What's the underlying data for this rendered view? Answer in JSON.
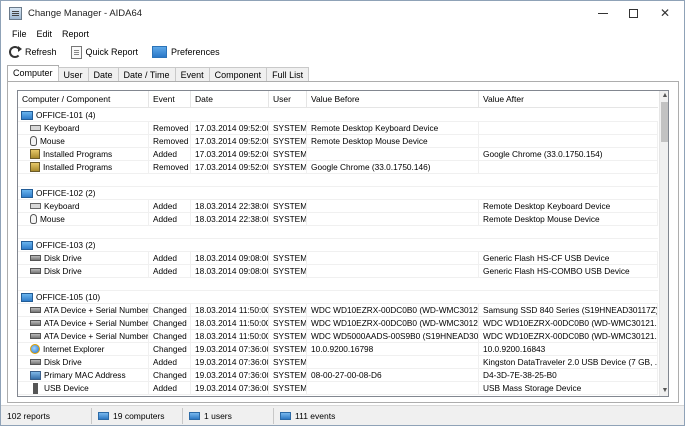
{
  "window": {
    "title": "Change Manager - AIDA64"
  },
  "menu": [
    "File",
    "Edit",
    "Report"
  ],
  "toolbar": {
    "refresh": "Refresh",
    "quick_report": "Quick Report",
    "preferences": "Preferences"
  },
  "tabs": [
    "Computer",
    "User",
    "Date",
    "Date / Time",
    "Event",
    "Component",
    "Full List"
  ],
  "columns": [
    "Computer / Component",
    "Event",
    "Date",
    "User",
    "Value Before",
    "Value After"
  ],
  "groups": [
    {
      "name": "OFFICE-101 (4)",
      "rows": [
        {
          "icon": "keyboard-icon",
          "component": "Keyboard",
          "event": "Removed",
          "date": "17.03.2014 09:52:00",
          "user": "SYSTEM",
          "before": "Remote Desktop Keyboard Device",
          "after": ""
        },
        {
          "icon": "mouse-icon",
          "component": "Mouse",
          "event": "Removed",
          "date": "17.03.2014 09:52:00",
          "user": "SYSTEM",
          "before": "Remote Desktop Mouse Device",
          "after": ""
        },
        {
          "icon": "installed-programs-icon",
          "component": "Installed Programs",
          "event": "Added",
          "date": "17.03.2014 09:52:00",
          "user": "SYSTEM",
          "before": "",
          "after": "Google Chrome (33.0.1750.154)"
        },
        {
          "icon": "installed-programs-icon",
          "component": "Installed Programs",
          "event": "Removed",
          "date": "17.03.2014 09:52:00",
          "user": "SYSTEM",
          "before": "Google Chrome (33.0.1750.146)",
          "after": ""
        }
      ]
    },
    {
      "name": "OFFICE-102 (2)",
      "rows": [
        {
          "icon": "keyboard-icon",
          "component": "Keyboard",
          "event": "Added",
          "date": "18.03.2014 22:38:00",
          "user": "SYSTEM",
          "before": "",
          "after": "Remote Desktop Keyboard Device"
        },
        {
          "icon": "mouse-icon",
          "component": "Mouse",
          "event": "Added",
          "date": "18.03.2014 22:38:00",
          "user": "SYSTEM",
          "before": "",
          "after": "Remote Desktop Mouse Device"
        }
      ]
    },
    {
      "name": "OFFICE-103 (2)",
      "rows": [
        {
          "icon": "disk-drive-icon",
          "component": "Disk Drive",
          "event": "Added",
          "date": "18.03.2014 09:08:00",
          "user": "SYSTEM",
          "before": "",
          "after": "Generic Flash HS-CF USB Device"
        },
        {
          "icon": "disk-drive-icon",
          "component": "Disk Drive",
          "event": "Added",
          "date": "18.03.2014 09:08:00",
          "user": "SYSTEM",
          "before": "",
          "after": "Generic Flash HS-COMBO USB Device"
        }
      ]
    },
    {
      "name": "OFFICE-105 (10)",
      "rows": [
        {
          "icon": "disk-drive-icon",
          "component": "ATA Device + Serial Number",
          "event": "Changed",
          "date": "18.03.2014 11:50:00",
          "user": "SYSTEM",
          "before": "WDC WD10EZRX-00DC0B0 (WD-WMC3012...",
          "after": "Samsung SSD 840 Series (S19HNEAD30117Z)"
        },
        {
          "icon": "disk-drive-icon",
          "component": "ATA Device + Serial Number",
          "event": "Changed",
          "date": "18.03.2014 11:50:00",
          "user": "SYSTEM",
          "before": "WDC WD10EZRX-00DC0B0 (WD-WMC3012...",
          "after": "WDC WD10EZRX-00DC0B0 (WD-WMC30121..."
        },
        {
          "icon": "disk-drive-icon",
          "component": "ATA Device + Serial Number",
          "event": "Changed",
          "date": "18.03.2014 11:50:00",
          "user": "SYSTEM",
          "before": "WDC WD5000AADS-00S9B0 (S19HNEAD30...",
          "after": "WDC WD10EZRX-00DC0B0 (WD-WMC30121..."
        },
        {
          "icon": "internet-explorer-icon",
          "component": "Internet Explorer",
          "event": "Changed",
          "date": "19.03.2014 07:36:00",
          "user": "SYSTEM",
          "before": "10.0.9200.16798",
          "after": "10.0.9200.16843"
        },
        {
          "icon": "disk-drive-icon",
          "component": "Disk Drive",
          "event": "Added",
          "date": "19.03.2014 07:36:00",
          "user": "SYSTEM",
          "before": "",
          "after": "Kingston DataTraveler 2.0 USB Device (7 GB, ..."
        },
        {
          "icon": "network-adapter-icon",
          "component": "Primary MAC Address",
          "event": "Changed",
          "date": "19.03.2014 07:36:00",
          "user": "SYSTEM",
          "before": "08-00-27-00-08-D6",
          "after": "D4-3D-7E-38-25-B0"
        },
        {
          "icon": "usb-device-icon",
          "component": "USB Device",
          "event": "Added",
          "date": "19.03.2014 07:36:00",
          "user": "SYSTEM",
          "before": "",
          "after": "USB Mass Storage Device"
        }
      ]
    }
  ],
  "status": {
    "reports": "102 reports",
    "computers": "19 computers",
    "users": "1 users",
    "events": "111 events"
  }
}
